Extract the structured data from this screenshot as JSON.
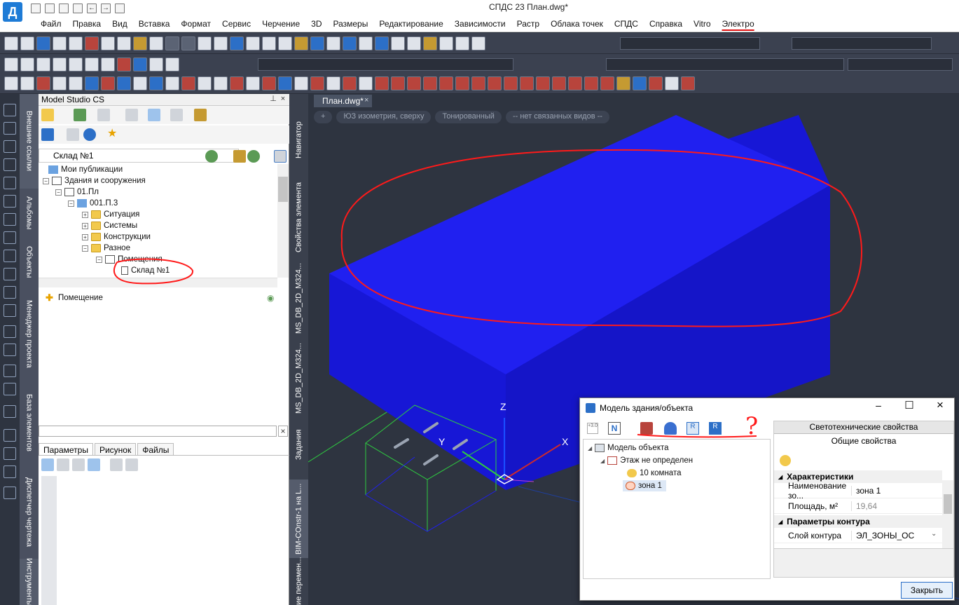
{
  "titlebar": {
    "title": "СПДС 23 План.dwg*",
    "logo": "Д"
  },
  "menu": {
    "items": [
      "Файл",
      "Правка",
      "Вид",
      "Вставка",
      "Формат",
      "Сервис",
      "Черчение",
      "3D",
      "Размеры",
      "Редактирование",
      "Зависимости",
      "Растр",
      "Облака точек",
      "СПДС",
      "Справка",
      "Vitro",
      "Электро"
    ],
    "highlighted_item": "Электро"
  },
  "left_rail_tabs": [
    "Внешние ссылки",
    "Альбомы",
    "Объекты",
    "Менеджер проекта",
    "База элементов",
    "Диспетчер чертежа",
    "Инструменты"
  ],
  "model_studio": {
    "title": "Model Studio CS",
    "current_path": "Склад №1",
    "tree": [
      {
        "label": "Мои публикации",
        "level": 1
      },
      {
        "label": "Здания и сооружения",
        "level": 1
      },
      {
        "label": "01.Пл",
        "level": 2
      },
      {
        "label": "001.П.3",
        "level": 3
      },
      {
        "label": "Ситуация",
        "level": 4
      },
      {
        "label": "Системы",
        "level": 4
      },
      {
        "label": "Конструкции",
        "level": 4
      },
      {
        "label": "Разное",
        "level": 4
      },
      {
        "label": "Помещения",
        "level": 5
      },
      {
        "label": "Склад №1",
        "level": 6
      }
    ],
    "lower_item": "Помещение",
    "tabs": [
      "Параметры",
      "Рисунок",
      "Файлы"
    ]
  },
  "side_tabs": [
    "Навигатор",
    "Свойства элемента",
    "MS_DB_2D_M324...",
    "MS_DB_2D_M324...",
    "Задания",
    "BIM-COnstr-1 на L...",
    "ние перемен..."
  ],
  "viewport": {
    "doc_tab": "План.dwg*",
    "view_controls": [
      "+",
      "ЮЗ изометрия, сверху",
      "Тонированный",
      "-- нет связанных видов --"
    ],
    "axis_labels": {
      "x": "X",
      "y": "Y",
      "z": "Z"
    },
    "annotation": "?",
    "colors": {
      "background": "#2e3440",
      "box_fill": "#1a1ae6",
      "box_top": "#1f1ff5",
      "highlight_ring": "#ff1a1a",
      "grid_green": "#2ecc40"
    }
  },
  "dialog": {
    "title": "Модель здания/объекта",
    "toolbar": {
      "label_n": "N"
    },
    "tree": [
      {
        "label": "Модель объекта",
        "level": 0
      },
      {
        "label": "Этаж не определен",
        "level": 1
      },
      {
        "label": "10 комната",
        "level": 2
      },
      {
        "label": "зона 1",
        "level": 2,
        "selected": true
      }
    ],
    "props": {
      "header_button": "Светотехнические свойства",
      "subheader": "Общие свойства",
      "categories": [
        {
          "name": "Характеристики",
          "rows": [
            {
              "key": "Наименование зо...",
              "value": "зона 1"
            },
            {
              "key": "Площадь, м²",
              "value": "19,64"
            }
          ]
        },
        {
          "name": "Параметры контура",
          "rows": [
            {
              "key": "Слой контура",
              "value": "ЭЛ_ЗОНЫ_ОС"
            }
          ]
        }
      ]
    },
    "close_button": "Закрыть"
  }
}
